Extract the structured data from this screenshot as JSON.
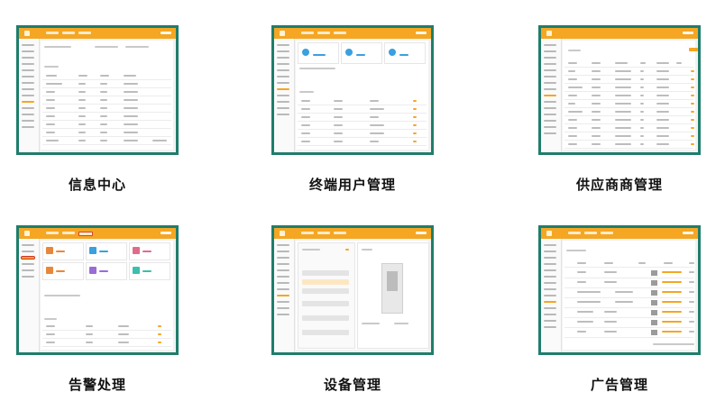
{
  "colors": {
    "frame": "#1f7d6b",
    "header": "#f5a623",
    "accent": "#f5a623"
  },
  "modules": [
    {
      "caption": "信息中心"
    },
    {
      "caption": "终端用户管理"
    },
    {
      "caption": "供应商商管理"
    },
    {
      "caption": "告警处理"
    },
    {
      "caption": "设备管理"
    },
    {
      "caption": "广告管理"
    }
  ]
}
